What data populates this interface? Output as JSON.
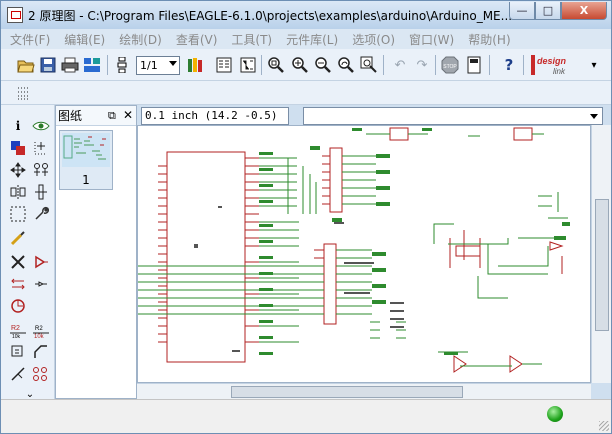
{
  "window": {
    "title": "2 原理图 - C:\\Program Files\\EAGLE-6.1.0\\projects\\examples\\arduino\\Arduino_ME...",
    "min_label": "—",
    "max_label": "□",
    "close_label": "X"
  },
  "menu": [
    {
      "label": "文件(F)"
    },
    {
      "label": "编辑(E)"
    },
    {
      "label": "绘制(D)"
    },
    {
      "label": "查看(V)"
    },
    {
      "label": "工具(T)"
    },
    {
      "label": "元件库(L)"
    },
    {
      "label": "选项(O)"
    },
    {
      "label": "窗口(W)"
    },
    {
      "label": "帮助(H)"
    }
  ],
  "toolbar": {
    "sheet_select": "1/1",
    "help_label": "?",
    "logo_line1": "design",
    "logo_line2": "link"
  },
  "sheets_panel": {
    "title": "图纸",
    "pin_label": "⧉",
    "close_label": "✕",
    "sheet_number": "1"
  },
  "coordinates": "0.1  inch  (14.2  -0.5)",
  "colors": {
    "schematic_green": "#2e8b2e",
    "schematic_red": "#b22222",
    "status_led": "#1da21a",
    "accent": "#cfdfef"
  }
}
